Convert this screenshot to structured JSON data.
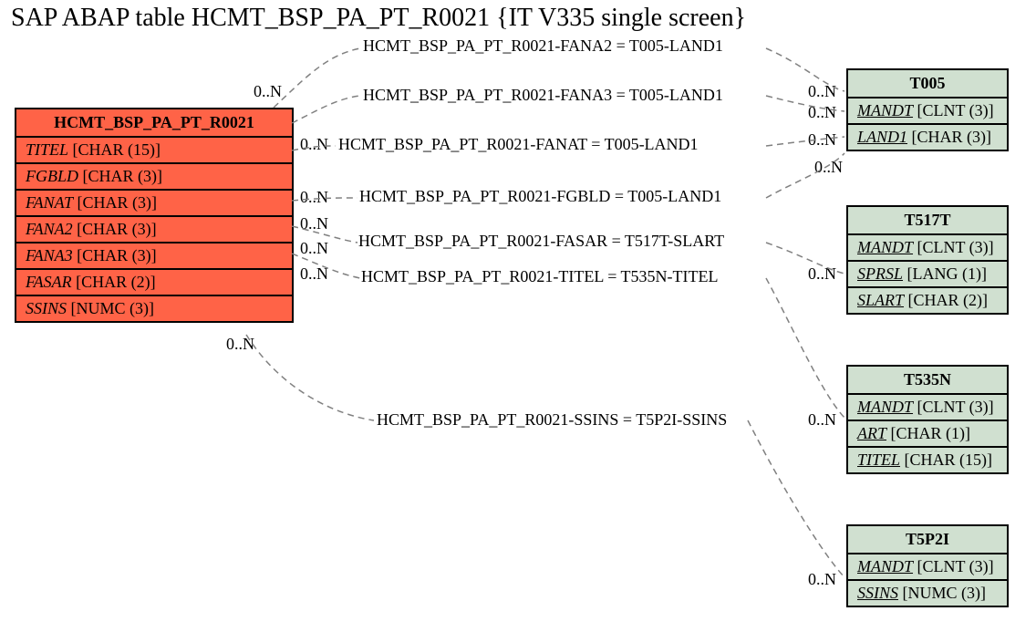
{
  "title": "SAP ABAP table HCMT_BSP_PA_PT_R0021 {IT V335 single screen}",
  "mainTable": {
    "name": "HCMT_BSP_PA_PT_R0021",
    "fields": [
      {
        "name": "TITEL",
        "type": "[CHAR (15)]"
      },
      {
        "name": "FGBLD",
        "type": "[CHAR (3)]"
      },
      {
        "name": "FANAT",
        "type": "[CHAR (3)]"
      },
      {
        "name": "FANA2",
        "type": "[CHAR (3)]"
      },
      {
        "name": "FANA3",
        "type": "[CHAR (3)]"
      },
      {
        "name": "FASAR",
        "type": "[CHAR (2)]"
      },
      {
        "name": "SSINS",
        "type": "[NUMC (3)]"
      }
    ]
  },
  "refTables": [
    {
      "name": "T005",
      "fields": [
        {
          "name": "MANDT",
          "type": "[CLNT (3)]",
          "u": true
        },
        {
          "name": "LAND1",
          "type": "[CHAR (3)]",
          "u": true
        }
      ]
    },
    {
      "name": "T517T",
      "fields": [
        {
          "name": "MANDT",
          "type": "[CLNT (3)]",
          "u": true
        },
        {
          "name": "SPRSL",
          "type": "[LANG (1)]",
          "u": true
        },
        {
          "name": "SLART",
          "type": "[CHAR (2)]",
          "u": true
        }
      ]
    },
    {
      "name": "T535N",
      "fields": [
        {
          "name": "MANDT",
          "type": "[CLNT (3)]",
          "u": true
        },
        {
          "name": "ART",
          "type": "[CHAR (1)]",
          "u": true
        },
        {
          "name": "TITEL",
          "type": "[CHAR (15)]",
          "u": true
        }
      ]
    },
    {
      "name": "T5P2I",
      "fields": [
        {
          "name": "MANDT",
          "type": "[CLNT (3)]",
          "u": true
        },
        {
          "name": "SSINS",
          "type": "[NUMC (3)]",
          "u": true
        }
      ]
    }
  ],
  "relations": [
    "HCMT_BSP_PA_PT_R0021-FANA2 = T005-LAND1",
    "HCMT_BSP_PA_PT_R0021-FANA3 = T005-LAND1",
    "HCMT_BSP_PA_PT_R0021-FANAT = T005-LAND1",
    "HCMT_BSP_PA_PT_R0021-FGBLD = T005-LAND1",
    "HCMT_BSP_PA_PT_R0021-FASAR = T517T-SLART",
    "HCMT_BSP_PA_PT_R0021-TITEL = T535N-TITEL",
    "HCMT_BSP_PA_PT_R0021-SSINS = T5P2I-SSINS"
  ],
  "card": {
    "c0": "0..N",
    "c1": "0..N",
    "c2": "0..N",
    "c3": "0..N",
    "c4": "0..N",
    "c5": "0..N",
    "c6": "0..N",
    "c7": "0..N",
    "r0": "0..N",
    "r1": "0..N",
    "r2": "0..N",
    "r3": "0..N",
    "r4": "0..N",
    "r5": "0..N",
    "r6": "0..N"
  }
}
